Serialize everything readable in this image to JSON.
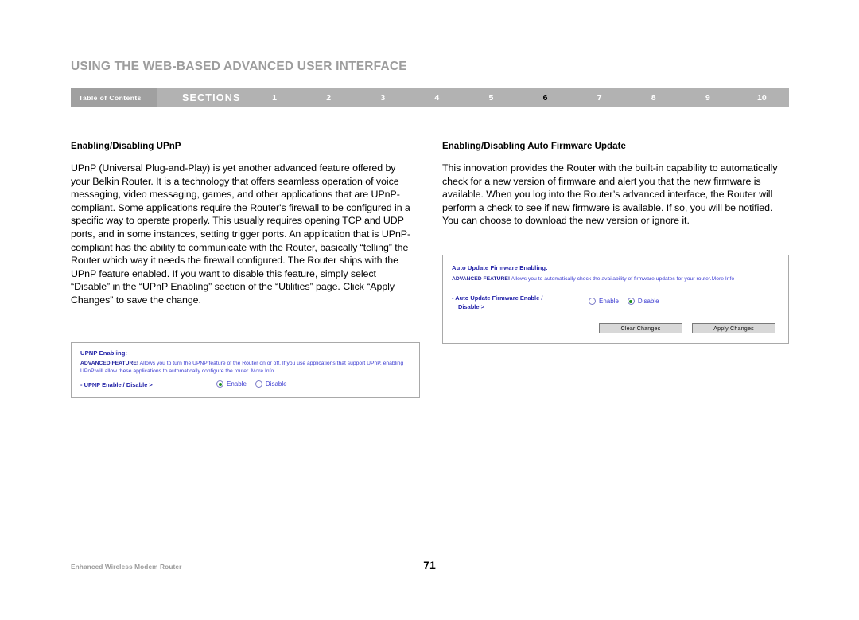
{
  "header": {
    "title": "USING THE WEB-BASED ADVANCED USER INTERFACE",
    "nav": {
      "toc_label": "Table of Contents",
      "sections_label": "SECTIONS",
      "numbers": [
        "1",
        "2",
        "3",
        "4",
        "5",
        "6",
        "7",
        "8",
        "9",
        "10"
      ],
      "active_number": "6",
      "bar_color": "#b2b2b2",
      "toc_color": "#a0a0a0",
      "active_color": "#000000",
      "inactive_color": "#ffffff"
    }
  },
  "left_column": {
    "heading": "Enabling/Disabling UPnP",
    "paragraph": "UPnP (Universal Plug-and-Play) is yet another advanced feature offered by your Belkin Router. It is a technology that offers seamless operation of voice messaging, video messaging, games, and other applications that are UPnP-compliant. Some applications require the Router's firewall to be configured in a specific way to operate properly. This usually requires opening TCP and UDP ports, and in some instances, setting trigger ports. An application that is UPnP-compliant has the ability to communicate with the Router, basically “telling” the Router which way it needs the firewall configured. The Router ships with the UPnP feature enabled. If you want to disable this feature, simply select “Disable” in the “UPnP Enabling” section of the “Utilities” page. Click “Apply Changes” to save the change."
  },
  "right_column": {
    "heading": "Enabling/Disabling Auto Firmware Update",
    "paragraph": "This innovation provides the Router with the built-in capability to automatically check for a new version of firmware and alert you that the new firmware is available. When you log into the Router’s advanced interface, the Router will perform a check to see if new firmware is available. If so, you will be notified. You can choose to download the new version or ignore it."
  },
  "upnp_panel": {
    "title": "UPNP Enabling:",
    "advanced_label": "ADVANCED FEATURE!",
    "description": " Allows you to turn the UPNP feature of the Router on or off. If you use applications that support UPnP, enabling UPnP will allow these applications to automatically configure the router. ",
    "more_info": "More Info",
    "field_label": "- UPNP Enable / Disable >",
    "options": [
      {
        "label": "Enable",
        "selected": true
      },
      {
        "label": "Disable",
        "selected": false
      }
    ]
  },
  "firmware_panel": {
    "title": "Auto Update Firmware Enabling:",
    "advanced_label": "ADVANCED FEATURE!",
    "description": " Allows you to automatically check the availability of firmware updates for your router.",
    "more_info": "More Info",
    "field_label_line1": "- Auto Update Firmware Enable /",
    "field_label_line2": "Disable >",
    "options": [
      {
        "label": "Enable",
        "selected": false
      },
      {
        "label": "Disable",
        "selected": true
      }
    ],
    "buttons": [
      {
        "label": "Clear Changes"
      },
      {
        "label": "Apply Changes"
      }
    ]
  },
  "footer": {
    "product": "Enhanced Wireless Modem Router",
    "page_number": "71"
  }
}
